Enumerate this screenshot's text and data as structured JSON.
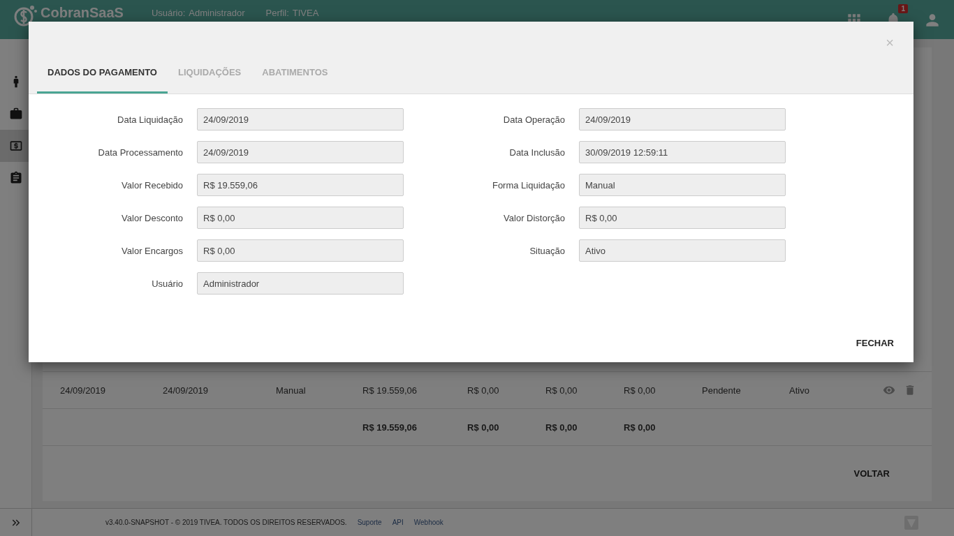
{
  "app": {
    "name": "CobranSaaS",
    "user_label": "Usuário:",
    "user": "Administrador",
    "profile_label": "Perfil:",
    "profile": "TIVEA",
    "notification_count": "1"
  },
  "sidebar": {
    "items": [
      {
        "kind": "person",
        "selected": false
      },
      {
        "kind": "briefcase",
        "selected": false
      },
      {
        "kind": "money",
        "selected": true
      },
      {
        "kind": "clipboard",
        "selected": false
      }
    ]
  },
  "table": {
    "rows": [
      {
        "kind": "data",
        "cells": [
          "24/09/2019",
          "24/09/2019",
          "Manual",
          "R$ 19.559,06",
          "R$ 0,00",
          "R$ 0,00",
          "R$ 0,00",
          "Pendente",
          "Ativo"
        ]
      },
      {
        "kind": "totals",
        "cells": [
          "",
          "",
          "",
          "R$ 19.559,06",
          "R$ 0,00",
          "R$ 0,00",
          "R$ 0,00"
        ]
      }
    ]
  },
  "back_button": "VOLTAR",
  "footer": {
    "text": "v3.40.0-SNAPSHOT - © 2019 TIVEA. TODOS OS DIREITOS RESERVADOS.",
    "links": [
      "Suporte",
      "API",
      "Webhook"
    ]
  },
  "modal": {
    "close": "×",
    "tabs": [
      {
        "label": "DADOS DO PAGAMENTO",
        "selected": true
      },
      {
        "label": "LIQUIDAÇÕES",
        "selected": false
      },
      {
        "label": "ABATIMENTOS",
        "selected": false
      }
    ],
    "left_fields": [
      {
        "label": "Data Liquidação",
        "value": "24/09/2019"
      },
      {
        "label": "Data Processamento",
        "value": "24/09/2019"
      },
      {
        "label": "Valor Recebido",
        "value": "R$ 19.559,06"
      },
      {
        "label": "Valor Desconto",
        "value": "R$ 0,00"
      },
      {
        "label": "Valor Encargos",
        "value": "R$ 0,00"
      },
      {
        "label": "Usuário",
        "value": "Administrador"
      }
    ],
    "right_fields": [
      {
        "label": "Data Operação",
        "value": "24/09/2019"
      },
      {
        "label": "Data Inclusão",
        "value": "30/09/2019 12:59:11"
      },
      {
        "label": "Forma Liquidação",
        "value": "Manual"
      },
      {
        "label": "Valor Distorção",
        "value": "R$ 0,00"
      },
      {
        "label": "Situação",
        "value": "Ativo"
      }
    ],
    "close_button": "FECHAR"
  }
}
